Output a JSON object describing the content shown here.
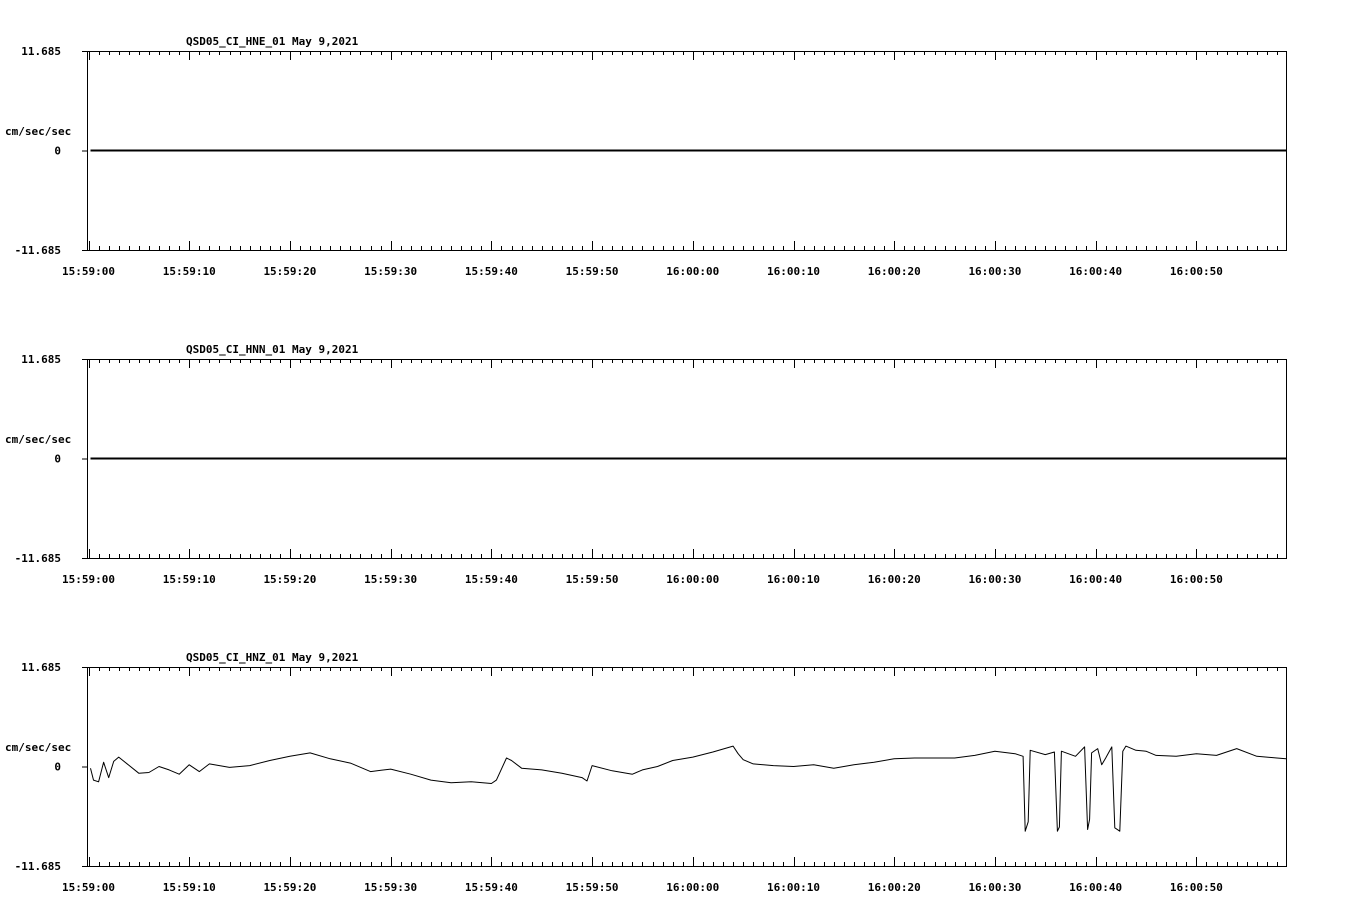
{
  "chart_data": [
    {
      "type": "line",
      "title": "QSD05_CI_HNE_01  May 9,2021",
      "ylabel": "cm/sec/sec",
      "ylim": [
        -11.685,
        11.685
      ],
      "yticks": [
        "11.685",
        "0",
        "-11.685"
      ],
      "xticks": [
        "15:59:00",
        "15:59:10",
        "15:59:20",
        "15:59:30",
        "15:59:40",
        "15:59:50",
        "16:00:00",
        "16:00:10",
        "16:00:20",
        "16:00:30",
        "16:00:40",
        "16:00:50"
      ],
      "xlim": [
        "15:58:59.85",
        "16:00:58.9"
      ],
      "series": [
        {
          "x": [
            "15:59:00.2",
            "16:00:58.9"
          ],
          "y": [
            0,
            0
          ]
        }
      ]
    },
    {
      "type": "line",
      "title": "QSD05_CI_HNN_01  May 9,2021",
      "ylabel": "cm/sec/sec",
      "ylim": [
        -11.685,
        11.685
      ],
      "yticks": [
        "11.685",
        "0",
        "-11.685"
      ],
      "xticks": [
        "15:59:00",
        "15:59:10",
        "15:59:20",
        "15:59:30",
        "15:59:40",
        "15:59:50",
        "16:00:00",
        "16:00:10",
        "16:00:20",
        "16:00:30",
        "16:00:40",
        "16:00:50"
      ],
      "xlim": [
        "15:58:59.85",
        "16:00:58.9"
      ],
      "series": [
        {
          "x": [
            "15:59:00.2",
            "16:00:58.9"
          ],
          "y": [
            0,
            0
          ]
        }
      ]
    },
    {
      "type": "line",
      "title": "QSD05_CI_HNZ_01  May 9,2021",
      "ylabel": "cm/sec/sec",
      "ylim": [
        -11.685,
        11.685
      ],
      "yticks": [
        "11.685",
        "0",
        "-11.685"
      ],
      "xticks": [
        "15:59:00",
        "15:59:10",
        "15:59:20",
        "15:59:30",
        "15:59:40",
        "15:59:50",
        "16:00:00",
        "16:00:10",
        "16:00:20",
        "16:00:30",
        "16:00:40",
        "16:00:50"
      ],
      "xlim": [
        "15:58:59.85",
        "16:00:58.9"
      ],
      "series": [
        {
          "x": [
            "15:59:00.2",
            "15:59:00.5",
            "15:59:01.0",
            "15:59:01.5",
            "15:59:02.0",
            "15:59:02.5",
            "15:59:03.0",
            "15:59:05.0",
            "15:59:06.0",
            "15:59:07.0",
            "15:59:08.0",
            "15:59:09.0",
            "15:59:10.0",
            "15:59:11.0",
            "15:59:12.0",
            "15:59:14.0",
            "15:59:16.0",
            "15:59:18.0",
            "15:59:20.0",
            "15:59:22.0",
            "15:59:24.0",
            "15:59:26.0",
            "15:59:28.0",
            "15:59:30.0",
            "15:59:32.0",
            "15:59:34.0",
            "15:59:36.0",
            "15:59:38.0",
            "15:59:40.0",
            "15:59:40.5",
            "15:59:41.5",
            "15:59:42.0",
            "15:59:43.0",
            "15:59:45.0",
            "15:59:47.0",
            "15:59:49.0",
            "15:59:49.5",
            "15:59:50.0",
            "15:59:52.0",
            "15:59:54.0",
            "15:59:55.0",
            "15:59:56.5",
            "15:59:58.0",
            "16:00:00.0",
            "16:00:02.0",
            "16:00:04.0",
            "16:00:04.5",
            "16:00:05.0",
            "16:00:06.0",
            "16:00:08.0",
            "16:00:10.0",
            "16:00:12.0",
            "16:00:14.0",
            "16:00:15.0",
            "16:00:16.0",
            "16:00:18.0",
            "16:00:20.0",
            "16:00:22.0",
            "16:00:24.0",
            "16:00:26.0",
            "16:00:28.0",
            "16:00:30.0",
            "16:00:32.0",
            "16:00:32.8",
            "16:00:33.0",
            "16:00:33.3",
            "16:00:33.5",
            "16:00:35.0",
            "16:00:35.9",
            "16:00:36.2",
            "16:00:36.4",
            "16:00:36.6",
            "16:00:38.0",
            "16:00:38.9",
            "16:00:39.2",
            "16:00:39.4",
            "16:00:39.6",
            "16:00:40.2",
            "16:00:40.6",
            "16:00:41.0",
            "16:00:41.6",
            "16:00:41.9",
            "16:00:42.4",
            "16:00:42.7",
            "16:00:43.0",
            "16:00:44.0",
            "16:00:45.0",
            "16:00:46.0",
            "16:00:48.0",
            "16:00:50.0",
            "16:00:52.0",
            "16:00:54.0",
            "16:00:56.0",
            "16:00:58.0",
            "16:00:58.9"
          ],
          "y": [
            -0.2,
            -1.6,
            -1.8,
            0.5,
            -1.3,
            0.6,
            1.1,
            -0.8,
            -0.7,
            0.0,
            -0.4,
            -0.9,
            0.2,
            -0.6,
            0.3,
            -0.1,
            0.1,
            0.7,
            1.2,
            1.6,
            0.9,
            0.4,
            -0.6,
            -0.3,
            -0.9,
            -1.6,
            -1.9,
            -1.8,
            -2.0,
            -1.6,
            1.0,
            0.7,
            -0.2,
            -0.4,
            -0.8,
            -1.3,
            -1.7,
            0.1,
            -0.5,
            -0.9,
            -0.4,
            0.0,
            0.7,
            1.1,
            1.7,
            2.4,
            1.5,
            0.8,
            0.3,
            0.1,
            0.0,
            0.2,
            -0.2,
            0.0,
            0.2,
            0.5,
            0.9,
            1.0,
            1.0,
            1.0,
            1.3,
            1.8,
            1.5,
            1.2,
            -7.6,
            -6.5,
            1.9,
            1.4,
            1.7,
            -7.6,
            -7.1,
            1.8,
            1.2,
            2.3,
            -7.4,
            -6.2,
            1.6,
            2.1,
            0.2,
            1.0,
            2.3,
            -7.2,
            -7.6,
            1.8,
            2.4,
            1.9,
            1.8,
            1.3,
            1.2,
            1.5,
            1.3,
            2.1,
            1.2,
            1.0,
            0.9
          ]
        }
      ]
    }
  ]
}
